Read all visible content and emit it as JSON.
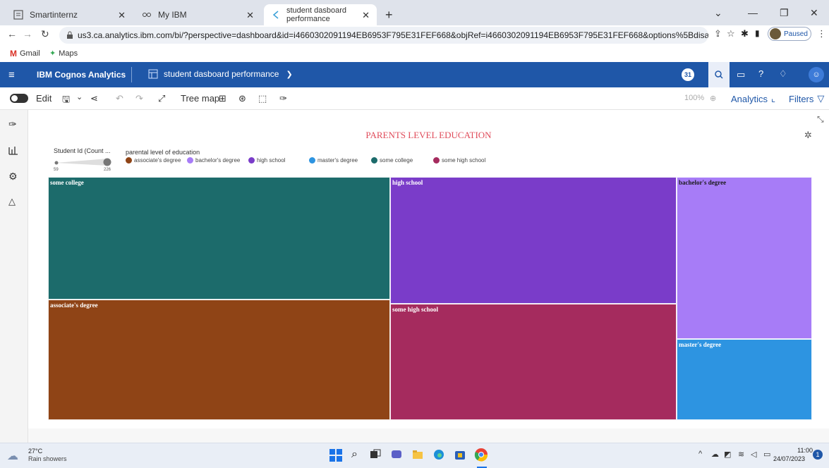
{
  "browser": {
    "tabs": [
      {
        "label": "Smartinternz"
      },
      {
        "label": "My IBM"
      },
      {
        "label": "student dasboard performance"
      }
    ],
    "url": "us3.ca.analytics.ibm.com/bi/?perspective=dashboard&id=i4660302091194EB6953F795E31FEF668&objRef=i4660302091194EB6953F795E31FEF668&options%5BdisableGlassPrefetch...",
    "profile_status": "Paused",
    "bookmarks": [
      {
        "label": "Gmail"
      },
      {
        "label": "Maps"
      }
    ]
  },
  "app": {
    "brand": "IBM Cognos Analytics",
    "dashboard_title": "student dasboard performance",
    "notif_count": "31"
  },
  "toolbar": {
    "edit_label": "Edit",
    "viz_type": "Tree map",
    "zoom": "100%",
    "analytics_label": "Analytics",
    "filters_label": "Filters"
  },
  "chart_data": {
    "type": "treemap",
    "title": "PARENTS LEVEL EDUCATION",
    "size_legend": {
      "label": "Student Id (Count ...",
      "min": "59",
      "max": "226"
    },
    "color_legend_title": "parental level of education",
    "categories": [
      "associate's degree",
      "bachelor's degree",
      "high school",
      "master's degree",
      "some college",
      "some high school"
    ],
    "colors": {
      "associate's degree": "#8f4416",
      "bachelor's degree": "#a77cf7",
      "high school": "#7a3cc9",
      "master's degree": "#2d94e1",
      "some college": "#1c6b6b",
      "some high school": "#a52b5e"
    },
    "label_colors": {
      "associate's degree": "#ffffff",
      "bachelor's degree": "#1a1a1a",
      "high school": "#ffffff",
      "master's degree": "#ffffff",
      "some college": "#ffffff",
      "some high school": "#ffffff"
    },
    "order": [
      "some college",
      "associate's degree",
      "high school",
      "some high school",
      "bachelor's degree",
      "master's degree"
    ],
    "values": {
      "some college": 226,
      "associate's degree": 222,
      "high school": 196,
      "some high school": 179,
      "bachelor's degree": 118,
      "master's degree": 59
    }
  },
  "taskbar": {
    "temp": "27°C",
    "weather": "Rain showers",
    "time": "11:00",
    "date": "24/07/2023",
    "notif_count": "1"
  }
}
